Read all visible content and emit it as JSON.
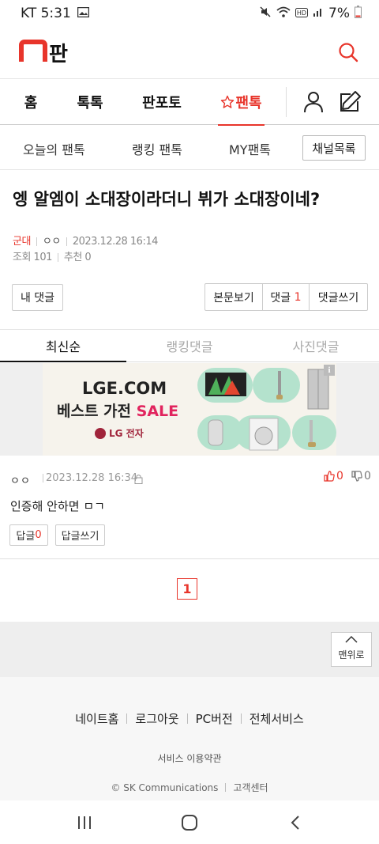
{
  "status_bar": {
    "carrier_time": "KT 5:31",
    "battery": "7%"
  },
  "header": {
    "logo_text": "판"
  },
  "main_nav": {
    "tabs": [
      {
        "label": "홈"
      },
      {
        "label": "톡톡"
      },
      {
        "label": "판포토"
      },
      {
        "label": "팬톡"
      }
    ]
  },
  "sub_nav": {
    "items": [
      {
        "label": "오늘의 팬톡"
      },
      {
        "label": "랭킹 팬톡"
      },
      {
        "label": "MY팬톡"
      }
    ],
    "channel_button": "채널목록"
  },
  "post": {
    "title": "엥 알엠이 소대장이라더니 뷔가 소대장이네?",
    "category": "군대",
    "author": "ㅇㅇ",
    "datetime": "2023.12.28 16:14",
    "views": "조회 101",
    "recommends": "추천 0"
  },
  "actions": {
    "my_comments": "내 댓글",
    "view_body": "본문보기",
    "comments_label": "댓글",
    "comments_count": "1",
    "write_comment": "댓글쓰기"
  },
  "comment_tabs": [
    {
      "label": "최신순",
      "active": true
    },
    {
      "label": "랭킹댓글",
      "active": false
    },
    {
      "label": "사진댓글",
      "active": false
    }
  ],
  "ad": {
    "line1": "LGE.COM",
    "line2": "베스트 가전",
    "line2_highlight": "SALE",
    "brand": "LG 전자",
    "info": "i"
  },
  "comments": [
    {
      "author": "ㅇㅇ",
      "datetime": "2023.12.28 16:34",
      "likes": "0",
      "dislikes": "0",
      "text": "인증해 안하면 ㅁㄱ",
      "reply_label": "답글",
      "reply_count": "0",
      "write_reply": "답글쓰기"
    }
  ],
  "pagination": {
    "current": "1"
  },
  "top_button": "맨위로",
  "footer": {
    "links": [
      "네이트홈",
      "로그아웃",
      "PC버전",
      "전체서비스"
    ],
    "terms": "서비스 이용약관",
    "copyright": "© SK Communications",
    "support": "고객센터"
  },
  "colors": {
    "accent": "#e8352b",
    "ad_sale": "#e1245e",
    "lg_brand": "#a0243b"
  }
}
